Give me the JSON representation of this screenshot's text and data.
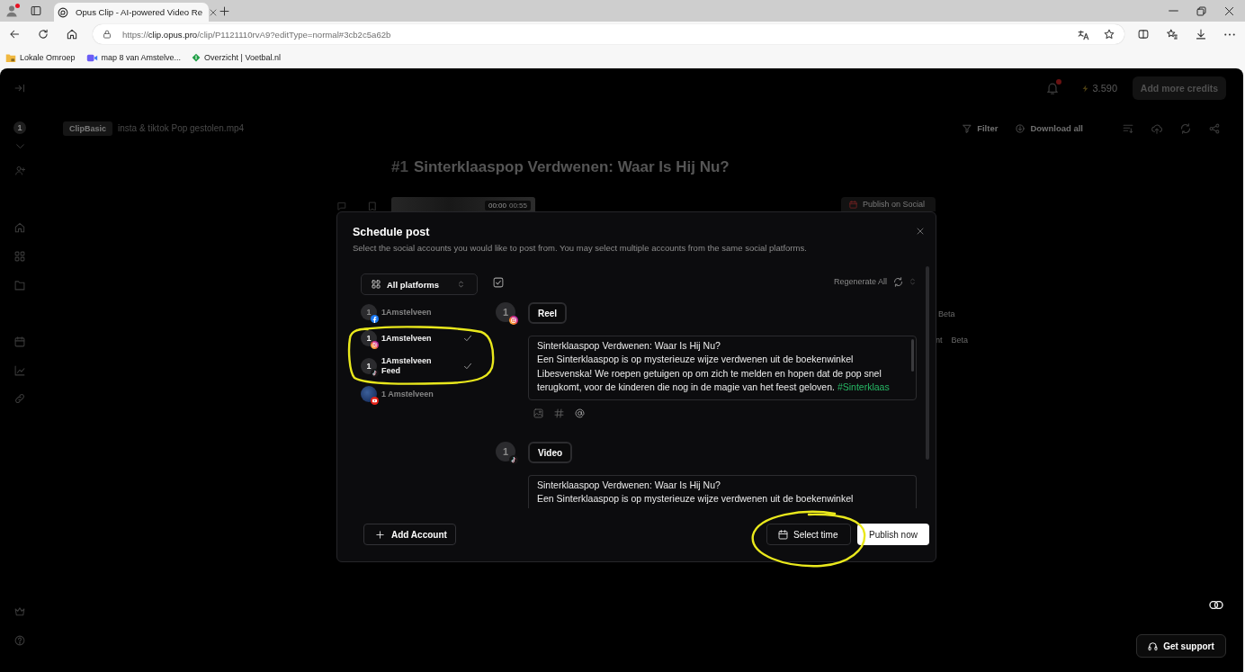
{
  "browser": {
    "tabs": [
      {
        "title": "Opus Clip - AI-powered Video Re",
        "selected": true
      }
    ],
    "address": {
      "scheme": "https://",
      "host": "clip.opus.pro",
      "path": "/clip/P1121110rvA9?editType=normal#3cb2c5a62b"
    },
    "bookmarks": [
      {
        "label": "Lokale Omroep",
        "kind": "folder"
      },
      {
        "label": "map 8 van Amstelve...",
        "kind": "video"
      },
      {
        "label": "Overzicht | Voetbal.nl",
        "kind": "site"
      }
    ]
  },
  "sidebar": {
    "count": "1"
  },
  "header": {
    "credits": "3.590",
    "add_credits": "Add more credits"
  },
  "toolbar": {
    "tag": "ClipBasic",
    "file_name": "insta & tiktok Pop gestolen.mp4",
    "filter": "Filter",
    "download_all": "Download all"
  },
  "clip": {
    "number": "#1",
    "title": "Sinterklaaspop Verdwenen: Waar Is Hij Nu?",
    "time_current": "00:00",
    "time_total": "00:55",
    "publish": "Publish on Social",
    "options": [
      {
        "badge": "Beta"
      },
      {
        "label": "nt",
        "badge": "Beta"
      }
    ]
  },
  "modal": {
    "title": "Schedule post",
    "subtitle": "Select the social accounts you would like to post from. You may select multiple accounts from the same social platforms.",
    "platform_filter": "All platforms",
    "select_all": {
      "checked": true
    },
    "accounts": [
      {
        "avatar": "1",
        "name": "1Amstelveen",
        "kind": "facebook",
        "selected": false
      },
      {
        "avatar": "1",
        "name": "1Amstelveen",
        "kind": "instagram",
        "selected": true
      },
      {
        "avatar": "1",
        "name": "1Amstelveen",
        "detail": "Feed",
        "kind": "tiktok",
        "selected": true
      },
      {
        "name": "1 Amstelveen",
        "kind": "youtube",
        "selected": false
      }
    ],
    "regenerate": "Regenerate All",
    "posts": [
      {
        "avatar": "1",
        "kind": "instagram",
        "format": "Reel",
        "caption_title": "Sinterklaaspop Verdwenen: Waar Is Hij Nu?",
        "caption": "Een Sinterklaaspop is op mysterieuze wijze verdwenen uit de boekenwinkel Libesvenska! We roepen getuigen op om zich te melden en hopen dat de pop snel terugkomt, voor de kinderen die nog in de magie van het feest geloven.",
        "hashtags": [
          "#Sinterklaas"
        ]
      },
      {
        "avatar": "1",
        "kind": "tiktok",
        "format": "Video",
        "caption_title": "Sinterklaaspop Verdwenen: Waar Is Hij Nu?",
        "caption": "Een Sinterklaaspop is op mysterieuze wijze verdwenen uit de boekenwinkel"
      }
    ],
    "add_account": "Add Account",
    "select_time": "Select time",
    "publish_now": "Publish now"
  },
  "support": "Get support"
}
